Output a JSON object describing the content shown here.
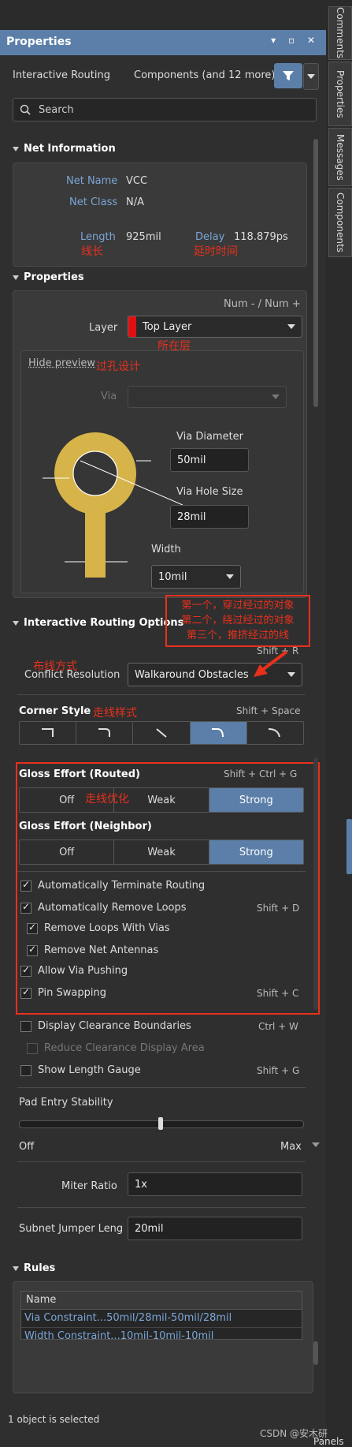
{
  "title": "Properties",
  "right_tabs": [
    "Comments",
    "Properties",
    "Messages",
    "Components"
  ],
  "header": {
    "mode": "Interactive Routing",
    "filter": "Components (and 12 more)"
  },
  "search": {
    "placeholder": "Search"
  },
  "net_info": {
    "heading": "Net Information",
    "net_name_label": "Net Name",
    "net_name": "VCC",
    "net_class_label": "Net Class",
    "net_class": "N/A",
    "length_label": "Length",
    "length": "925mil",
    "length_anno": "线长",
    "delay_label": "Delay",
    "delay": "118.879ps",
    "delay_anno": "延时时间"
  },
  "properties": {
    "heading": "Properties",
    "num_hint": "Num - / Num +",
    "layer_label": "Layer",
    "layer_value": "Top Layer",
    "layer_color": "#e01010",
    "layer_anno": "所在层",
    "hide_preview": "Hide preview",
    "via_anno": "过孔设计",
    "via_label": "Via",
    "via_diameter_label": "Via Diameter",
    "via_diameter": "50mil",
    "via_hole_label": "Via Hole Size",
    "via_hole": "28mil",
    "width_label": "Width",
    "width": "10mil"
  },
  "iro": {
    "heading": "Interactive Routing Options",
    "anno_lines": [
      "第一个，穿过经过的对象",
      "第二个，绕过经过的对象",
      "第三个，推挤经过的线"
    ],
    "shortcut_conflict": "Shift + R",
    "conflict_anno": "布线方式",
    "conflict_label": "Conflict Resolution",
    "conflict_value": "Walkaround Obstacles",
    "corner_label": "Corner Style",
    "corner_anno": "走线样式",
    "corner_shortcut": "Shift + Space",
    "gloss_routed_label": "Gloss Effort (Routed)",
    "gloss_routed_shortcut": "Shift + Ctrl + G",
    "gloss_anno": "走线优化",
    "gloss_options": [
      "Off",
      "Weak",
      "Strong"
    ],
    "gloss_neighbor_label": "Gloss Effort (Neighbor)",
    "checks": [
      {
        "label": "Automatically Terminate Routing",
        "shortcut": ""
      },
      {
        "label": "Automatically Remove Loops",
        "shortcut": "Shift + D"
      },
      {
        "label": "Remove Loops With Vias",
        "shortcut": ""
      },
      {
        "label": "Remove Net Antennas",
        "shortcut": ""
      },
      {
        "label": "Allow Via Pushing",
        "shortcut": ""
      },
      {
        "label": "Pin Swapping",
        "shortcut": "Shift + C"
      },
      {
        "label": "Display Clearance Boundaries",
        "shortcut": "Ctrl + W"
      },
      {
        "label": "Reduce Clearance Display Area",
        "shortcut": ""
      },
      {
        "label": "Show Length Gauge",
        "shortcut": "Shift + G"
      }
    ],
    "pad_entry_label": "Pad Entry Stability",
    "pad_off": "Off",
    "pad_max": "Max",
    "pad_value": 0.5,
    "miter_label": "Miter Ratio",
    "miter_value": "1x",
    "subnet_label": "Subnet Jumper Leng",
    "subnet_value": "20mil"
  },
  "rules": {
    "heading": "Rules",
    "column": "Name",
    "items": [
      "Via Constraint...50mil/28mil-50mil/28mil",
      "Width Constraint...10mil-10mil-10mil"
    ]
  },
  "status": {
    "selected": "1 object is selected",
    "watermark": "CSDN @安木研",
    "panels": "Panels"
  },
  "colors": {
    "accent": "#5b7fa8",
    "annotation": "#e8301c",
    "via": "#d6b44a"
  }
}
